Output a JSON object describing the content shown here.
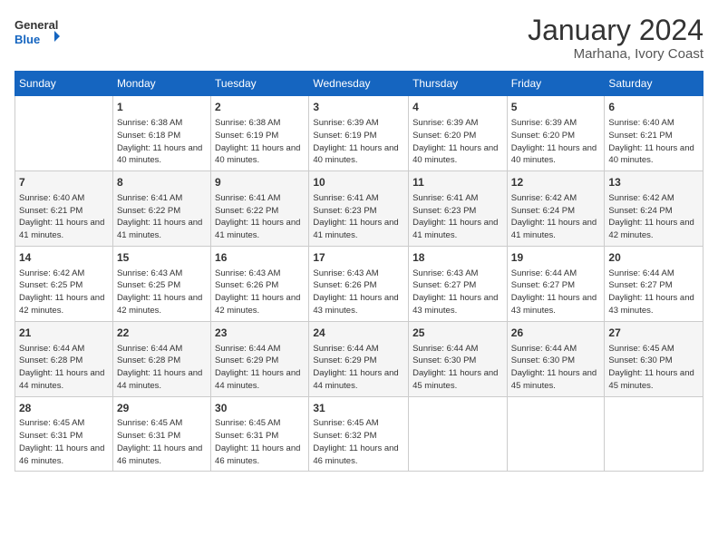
{
  "header": {
    "logo_general": "General",
    "logo_blue": "Blue",
    "month_year": "January 2024",
    "location": "Marhana, Ivory Coast"
  },
  "weekdays": [
    "Sunday",
    "Monday",
    "Tuesday",
    "Wednesday",
    "Thursday",
    "Friday",
    "Saturday"
  ],
  "weeks": [
    [
      {
        "day": "",
        "info": ""
      },
      {
        "day": "1",
        "info": "Sunrise: 6:38 AM\nSunset: 6:18 PM\nDaylight: 11 hours and 40 minutes."
      },
      {
        "day": "2",
        "info": "Sunrise: 6:38 AM\nSunset: 6:19 PM\nDaylight: 11 hours and 40 minutes."
      },
      {
        "day": "3",
        "info": "Sunrise: 6:39 AM\nSunset: 6:19 PM\nDaylight: 11 hours and 40 minutes."
      },
      {
        "day": "4",
        "info": "Sunrise: 6:39 AM\nSunset: 6:20 PM\nDaylight: 11 hours and 40 minutes."
      },
      {
        "day": "5",
        "info": "Sunrise: 6:39 AM\nSunset: 6:20 PM\nDaylight: 11 hours and 40 minutes."
      },
      {
        "day": "6",
        "info": "Sunrise: 6:40 AM\nSunset: 6:21 PM\nDaylight: 11 hours and 40 minutes."
      }
    ],
    [
      {
        "day": "7",
        "info": "Sunrise: 6:40 AM\nSunset: 6:21 PM\nDaylight: 11 hours and 41 minutes."
      },
      {
        "day": "8",
        "info": "Sunrise: 6:41 AM\nSunset: 6:22 PM\nDaylight: 11 hours and 41 minutes."
      },
      {
        "day": "9",
        "info": "Sunrise: 6:41 AM\nSunset: 6:22 PM\nDaylight: 11 hours and 41 minutes."
      },
      {
        "day": "10",
        "info": "Sunrise: 6:41 AM\nSunset: 6:23 PM\nDaylight: 11 hours and 41 minutes."
      },
      {
        "day": "11",
        "info": "Sunrise: 6:41 AM\nSunset: 6:23 PM\nDaylight: 11 hours and 41 minutes."
      },
      {
        "day": "12",
        "info": "Sunrise: 6:42 AM\nSunset: 6:24 PM\nDaylight: 11 hours and 41 minutes."
      },
      {
        "day": "13",
        "info": "Sunrise: 6:42 AM\nSunset: 6:24 PM\nDaylight: 11 hours and 42 minutes."
      }
    ],
    [
      {
        "day": "14",
        "info": "Sunrise: 6:42 AM\nSunset: 6:25 PM\nDaylight: 11 hours and 42 minutes."
      },
      {
        "day": "15",
        "info": "Sunrise: 6:43 AM\nSunset: 6:25 PM\nDaylight: 11 hours and 42 minutes."
      },
      {
        "day": "16",
        "info": "Sunrise: 6:43 AM\nSunset: 6:26 PM\nDaylight: 11 hours and 42 minutes."
      },
      {
        "day": "17",
        "info": "Sunrise: 6:43 AM\nSunset: 6:26 PM\nDaylight: 11 hours and 43 minutes."
      },
      {
        "day": "18",
        "info": "Sunrise: 6:43 AM\nSunset: 6:27 PM\nDaylight: 11 hours and 43 minutes."
      },
      {
        "day": "19",
        "info": "Sunrise: 6:44 AM\nSunset: 6:27 PM\nDaylight: 11 hours and 43 minutes."
      },
      {
        "day": "20",
        "info": "Sunrise: 6:44 AM\nSunset: 6:27 PM\nDaylight: 11 hours and 43 minutes."
      }
    ],
    [
      {
        "day": "21",
        "info": "Sunrise: 6:44 AM\nSunset: 6:28 PM\nDaylight: 11 hours and 44 minutes."
      },
      {
        "day": "22",
        "info": "Sunrise: 6:44 AM\nSunset: 6:28 PM\nDaylight: 11 hours and 44 minutes."
      },
      {
        "day": "23",
        "info": "Sunrise: 6:44 AM\nSunset: 6:29 PM\nDaylight: 11 hours and 44 minutes."
      },
      {
        "day": "24",
        "info": "Sunrise: 6:44 AM\nSunset: 6:29 PM\nDaylight: 11 hours and 44 minutes."
      },
      {
        "day": "25",
        "info": "Sunrise: 6:44 AM\nSunset: 6:30 PM\nDaylight: 11 hours and 45 minutes."
      },
      {
        "day": "26",
        "info": "Sunrise: 6:44 AM\nSunset: 6:30 PM\nDaylight: 11 hours and 45 minutes."
      },
      {
        "day": "27",
        "info": "Sunrise: 6:45 AM\nSunset: 6:30 PM\nDaylight: 11 hours and 45 minutes."
      }
    ],
    [
      {
        "day": "28",
        "info": "Sunrise: 6:45 AM\nSunset: 6:31 PM\nDaylight: 11 hours and 46 minutes."
      },
      {
        "day": "29",
        "info": "Sunrise: 6:45 AM\nSunset: 6:31 PM\nDaylight: 11 hours and 46 minutes."
      },
      {
        "day": "30",
        "info": "Sunrise: 6:45 AM\nSunset: 6:31 PM\nDaylight: 11 hours and 46 minutes."
      },
      {
        "day": "31",
        "info": "Sunrise: 6:45 AM\nSunset: 6:32 PM\nDaylight: 11 hours and 46 minutes."
      },
      {
        "day": "",
        "info": ""
      },
      {
        "day": "",
        "info": ""
      },
      {
        "day": "",
        "info": ""
      }
    ]
  ]
}
